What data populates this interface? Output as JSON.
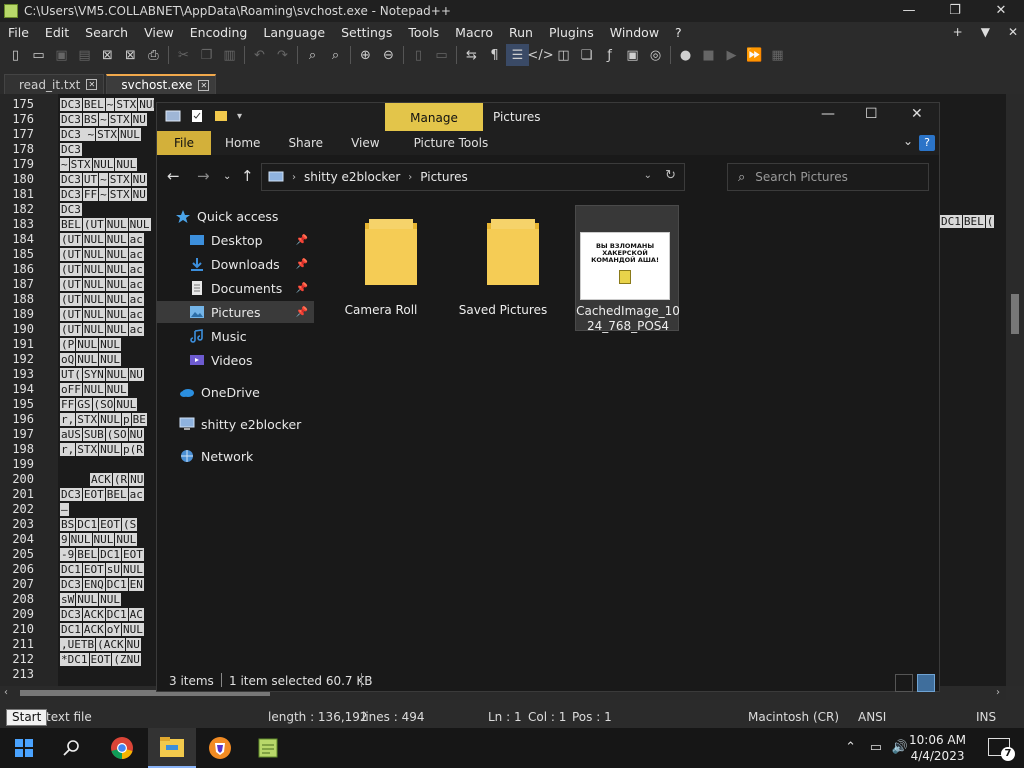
{
  "npp": {
    "title": "C:\\Users\\VM5.COLLABNET\\AppData\\Roaming\\svchost.exe - Notepad++",
    "window_controls": [
      "—",
      "❐",
      "✕"
    ],
    "menu": [
      "File",
      "Edit",
      "Search",
      "View",
      "Encoding",
      "Language",
      "Settings",
      "Tools",
      "Macro",
      "Run",
      "Plugins",
      "Window",
      "?"
    ],
    "menu_right": [
      "+",
      "▼",
      "✕"
    ],
    "tabs": [
      {
        "label": "read_it.txt",
        "active": false
      },
      {
        "label": "svchost.exe",
        "active": true
      }
    ],
    "line_numbers": [
      "175",
      "176",
      "177",
      "178",
      "179",
      "180",
      "181",
      "182",
      "183",
      "184",
      "185",
      "186",
      "187",
      "188",
      "189",
      "190",
      "191",
      "192",
      "193",
      "194",
      "195",
      "196",
      "197",
      "198",
      "199",
      "200",
      "201",
      "202",
      "203",
      "204",
      "205",
      "206",
      "207",
      "208",
      "209",
      "210",
      "211",
      "212",
      "213"
    ],
    "code_lines": [
      [
        "DC3",
        "BEL",
        "~",
        "STX",
        "NUL"
      ],
      [
        "DC3",
        "BS",
        "~",
        "STX",
        "NU"
      ],
      [
        "DC3 ~",
        "STX",
        "NUL"
      ],
      [
        "DC3"
      ],
      [
        "~",
        "STX",
        "NUL",
        "NUL"
      ],
      [
        "DC3",
        "UT",
        "~",
        "STX",
        "NU"
      ],
      [
        "DC3",
        "FF",
        "~",
        "STX",
        "NU"
      ],
      [
        "DC3"
      ],
      [
        "BEL",
        "(UT",
        "NUL",
        "NUL"
      ],
      [
        "(UT",
        "NUL",
        "NUL",
        "ac"
      ],
      [
        "(UT",
        "NUL",
        "NUL",
        "ac"
      ],
      [
        "(UT",
        "NUL",
        "NUL",
        "ac"
      ],
      [
        "(UT",
        "NUL",
        "NUL",
        "ac"
      ],
      [
        "(UT",
        "NUL",
        "NUL",
        "ac"
      ],
      [
        "(UT",
        "NUL",
        "NUL",
        "ac"
      ],
      [
        "(UT",
        "NUL",
        "NUL",
        "ac"
      ],
      [
        "(P",
        "NUL",
        "NUL"
      ],
      [
        "oQ",
        "NUL",
        "NUL"
      ],
      [
        "UT(",
        "SYN",
        "NUL",
        "NU"
      ],
      [
        "oFF",
        "NUL",
        "NUL"
      ],
      [
        "FF",
        "GS",
        "(SO",
        "NUL"
      ],
      [
        "r,",
        "STX",
        "NUL",
        "p",
        "BE"
      ],
      [
        "aUS",
        "SUB",
        "(SO",
        "NU"
      ],
      [
        "r,",
        "STX",
        "NUL",
        "p(R"
      ],
      [],
      [
        "ACK",
        "(R",
        "NU"
      ],
      [
        "DC3",
        "EOT",
        "BEL",
        "ac"
      ],
      [
        "–"
      ],
      [
        "BS",
        "DC1",
        "EOT",
        "(S"
      ],
      [
        "9",
        "NUL",
        "NUL",
        "NUL"
      ],
      [
        "-9",
        "BEL",
        "DC1",
        "EOT"
      ],
      [
        "DC1",
        "EOT",
        "sU",
        "NUL"
      ],
      [
        "DC3",
        "ENQ",
        "DC1",
        "EN"
      ],
      [
        "sW",
        "NUL",
        "NUL"
      ],
      [
        "DC3",
        "ACK",
        "DC1",
        "AC"
      ],
      [
        "DC1",
        "ACK",
        "oY",
        "NUL"
      ],
      [
        ",UETB",
        "(ACK",
        "NU"
      ],
      [
        "*DC1",
        "EOT",
        "(ZNU"
      ]
    ],
    "code_right": [
      "DC1",
      "BEL",
      "("
    ],
    "status": {
      "type": "text file",
      "length": "length : 136,192",
      "lines": "lines : 494",
      "ln": "Ln : 1",
      "col": "Col : 1",
      "pos": "Pos : 1",
      "eol": "Macintosh (CR)",
      "encoding": "ANSI",
      "mode": "INS"
    },
    "start_tooltip": "Start"
  },
  "explorer": {
    "title": "Pictures",
    "manage_tab": "Manage",
    "ribbon_tabs": [
      "File",
      "Home",
      "Share",
      "View",
      "Picture Tools"
    ],
    "breadcrumb": [
      "shitty e2blocker",
      "Pictures"
    ],
    "search_placeholder": "Search Pictures",
    "nav_items": [
      {
        "label": "Quick access",
        "icon": "star-icon",
        "pinned": false,
        "selected": false
      },
      {
        "label": "Desktop",
        "icon": "desktop-icon",
        "pinned": true,
        "selected": false
      },
      {
        "label": "Downloads",
        "icon": "download-icon",
        "pinned": true,
        "selected": false
      },
      {
        "label": "Documents",
        "icon": "document-icon",
        "pinned": true,
        "selected": false
      },
      {
        "label": "Pictures",
        "icon": "pictures-icon",
        "pinned": true,
        "selected": true
      },
      {
        "label": "Music",
        "icon": "music-icon",
        "pinned": false,
        "selected": false
      },
      {
        "label": "Videos",
        "icon": "video-icon",
        "pinned": false,
        "selected": false
      },
      {
        "label": "OneDrive",
        "icon": "cloud-icon",
        "pinned": false,
        "selected": false
      },
      {
        "label": "shitty e2blocker",
        "icon": "computer-icon",
        "pinned": false,
        "selected": false
      },
      {
        "label": "Network",
        "icon": "network-icon",
        "pinned": false,
        "selected": false
      }
    ],
    "items": [
      {
        "name": "Camera Roll",
        "type": "folder",
        "selected": false
      },
      {
        "name": "Saved Pictures",
        "type": "folder",
        "selected": false
      },
      {
        "name": "CachedImage_1024_768_POS4",
        "name_lines": [
          "CachedImage_10",
          "24_768_POS4"
        ],
        "type": "image",
        "selected": true,
        "thumb_text": [
          "ВЫ ВЗЛОМАНЫ",
          "ХАКЕРСКОЙ",
          "КОМАНДОЙ АША!"
        ]
      }
    ],
    "status": {
      "count": "3 items",
      "selection": "1 item selected  60.7 KB"
    }
  },
  "taskbar": {
    "apps": [
      "start-icon",
      "search-icon",
      "chrome-icon",
      "file-explorer-icon",
      "brave-icon",
      "notepadpp-icon"
    ],
    "time": "10:06 AM",
    "date": "4/4/2023",
    "notification_count": "7"
  },
  "colors": {
    "accent_manage": "#e3c54a",
    "accent_file": "#d3b03a",
    "tab_highlight": "#f2a94c"
  }
}
